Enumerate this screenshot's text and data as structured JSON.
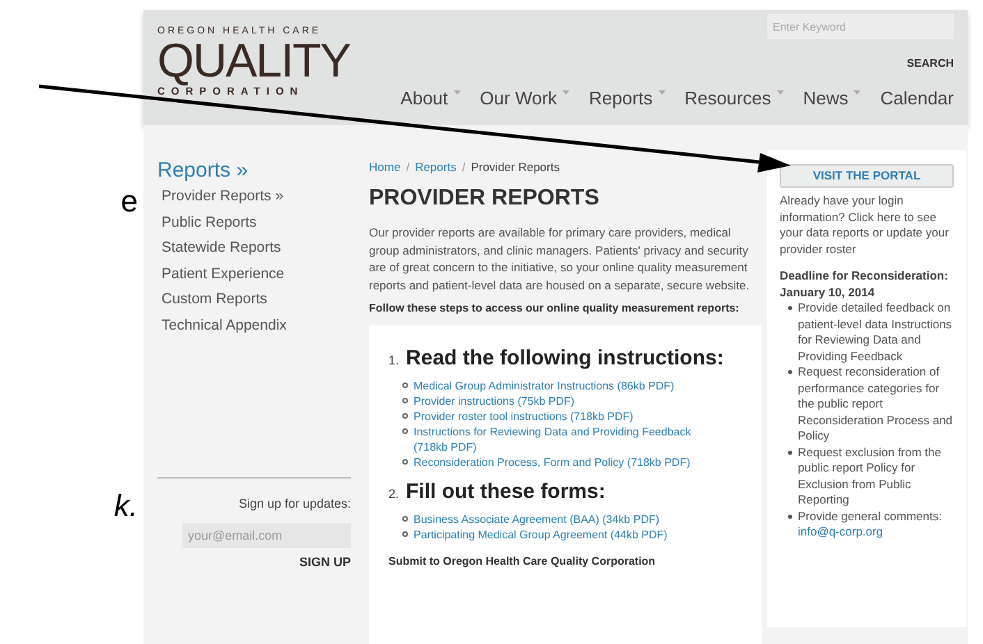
{
  "fragments": [
    {
      "text": "e",
      "italic": false
    },
    {
      "text": "k.",
      "italic": true
    }
  ],
  "header": {
    "logo": {
      "top": "OREGON HEALTH CARE",
      "main": "QUALITY",
      "bottom": "CORPORATION"
    },
    "search": {
      "placeholder": "Enter Keyword",
      "button": "SEARCH"
    },
    "nav": [
      {
        "label": "About",
        "dropdown": true
      },
      {
        "label": "Our Work",
        "dropdown": true
      },
      {
        "label": "Reports",
        "dropdown": true
      },
      {
        "label": "Resources",
        "dropdown": true
      },
      {
        "label": "News",
        "dropdown": true
      },
      {
        "label": "Calendar",
        "dropdown": false
      }
    ]
  },
  "sidebar": {
    "title": "Reports »",
    "items": [
      "Provider Reports »",
      "Public Reports",
      "Statewide Reports",
      "Patient Experience",
      "Custom Reports",
      "Technical Appendix"
    ],
    "signup": {
      "label": "Sign up for updates:",
      "placeholder": "your@email.com",
      "button": "SIGN UP"
    }
  },
  "breadcrumb_separator": "/",
  "breadcrumb": [
    {
      "label": "Home",
      "link": true
    },
    {
      "label": "Reports",
      "link": true
    },
    {
      "label": "Provider Reports",
      "link": false
    }
  ],
  "title": "PROVIDER REPORTS",
  "intro": "Our provider reports are available for primary care providers, medical group administrators, and clinic managers. Patients' privacy and security are of great concern to the initiative, so your online quality measurement reports and patient-level data are housed on a separate, secure website.",
  "steps_intro": "Follow these steps to access our online quality measurement reports:",
  "steps": [
    {
      "number": "1.",
      "title": "Read the following instructions:",
      "links": [
        "Medical Group Administrator Instructions (86kb PDF)",
        "Provider instructions (75kb PDF)",
        "Provider roster tool instructions (718kb PDF)",
        "Instructions for Reviewing Data and Providing Feedback (718kb PDF)",
        "Reconsideration Process, Form and Policy (718kb PDF)"
      ]
    },
    {
      "number": "2.",
      "title": "Fill out these forms:",
      "links": [
        "Business Associate Agreement (BAA) (34kb PDF)",
        "Participating Medical Group Agreement (44kb PDF)"
      ]
    }
  ],
  "submit": "Submit to Oregon Health Care Quality Corporation",
  "portal": {
    "button": "VISIT THE PORTAL",
    "text": "Already have your login information? Click here to see your data reports or update your provider roster",
    "deadline": "Deadline for Reconsideration: January 10, 2014",
    "bullets": [
      {
        "text": "Provide detailed feedback on patient-level data Instructions for Reviewing Data and Providing Feedback"
      },
      {
        "text": "Request reconsideration of performance categories for the public report Reconsideration Process and Policy"
      },
      {
        "text": "Request exclusion from the public report Policy for Exclusion from Public Reporting"
      },
      {
        "text": "Provide general comments:",
        "link": "info@q-corp.org"
      }
    ]
  }
}
